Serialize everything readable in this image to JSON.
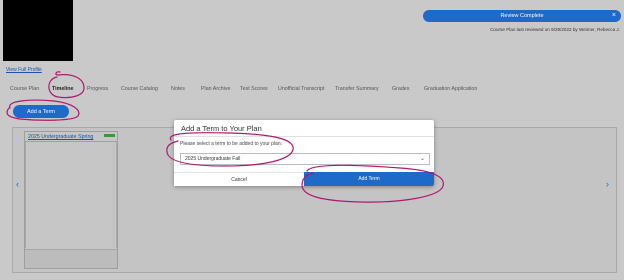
{
  "header": {
    "review_button": "Review Complete",
    "close_glyph": "×",
    "reviewed_text": "Course Plan last reviewed on 9/29/2022 by Weimer, Rebecca J."
  },
  "profile_link": "View Full Profile",
  "tabs": [
    {
      "label": "Course Plan"
    },
    {
      "label": "Timeline"
    },
    {
      "label": "Progress"
    },
    {
      "label": "Course Catalog"
    },
    {
      "label": "Notes"
    },
    {
      "label": "Plan Archive"
    },
    {
      "label": "Test Scores"
    },
    {
      "label": "Unofficial Transcript"
    },
    {
      "label": "Transfer Summary"
    },
    {
      "label": "Grades"
    },
    {
      "label": "Graduation Application"
    }
  ],
  "active_tab": "Timeline",
  "add_term_button": "Add a Term",
  "timeline": {
    "term_title": "2025 Undergraduate Spring",
    "prev_glyph": "‹",
    "next_glyph": "›"
  },
  "modal": {
    "title": "Add a Term to Your Plan",
    "label": "Please select a term to be added to your plan:",
    "selected_term": "2025 Undergraduate Fall",
    "chevron": "⌄",
    "cancel_label": "Cancel",
    "add_label": "Add Term"
  },
  "colors": {
    "accent": "#1d6ac9",
    "annotation": "#b0176e",
    "status_flag": "#3a9a3a"
  }
}
